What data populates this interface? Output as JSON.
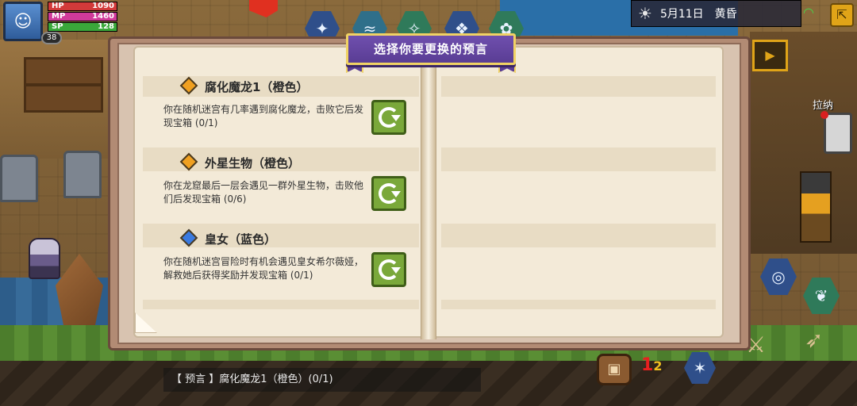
{
  "hud": {
    "hp_label": "HP",
    "hp_value": "1090",
    "hp_fill": 1.0,
    "mp_label": "MP",
    "mp_value": "1460",
    "mp_fill": 1.0,
    "sp_label": "SP",
    "sp_value": "128",
    "sp_fill": 1.0,
    "level": "38",
    "date": "5月11日",
    "time_of_day": "黄昏",
    "side_label": "拉纳"
  },
  "dialog": {
    "title": "选择你要更换的预言",
    "entries": [
      {
        "title": "腐化魔龙1（橙色）",
        "gem_color": "#f0a020",
        "desc": "你在随机迷宫有几率遇到腐化魔龙，击败它后发现宝箱 (0/1)",
        "button_icon": "refresh-icon"
      },
      {
        "title": "外星生物（橙色）",
        "gem_color": "#f0a020",
        "desc": "你在龙窟最后一层会遇见一群外星生物，击败他们后发现宝箱 (0/6)",
        "button_icon": "refresh-icon"
      },
      {
        "title": "皇女（蓝色）",
        "gem_color": "#3a7ae0",
        "desc": "你在随机迷宫冒险时有机会遇见皇女希尔薇娅，解救她后获得奖励并发现宝箱 (0/1)",
        "button_icon": "refresh-icon"
      }
    ]
  },
  "log": {
    "text": "【 预言 】腐化魔龙1（橙色）(0/1)"
  }
}
